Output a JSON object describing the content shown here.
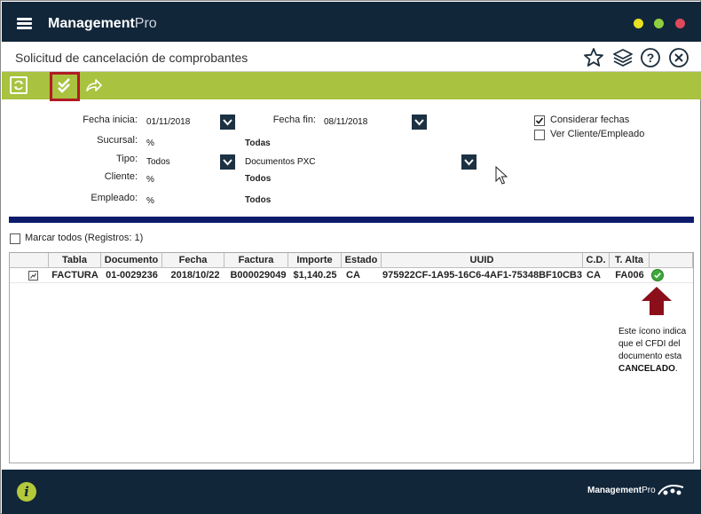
{
  "app": {
    "brand_main": "Management",
    "brand_pro": "Pro"
  },
  "window_controls": [
    "minimize",
    "maximize",
    "close"
  ],
  "header": {
    "title": "Solicitud de cancelación de comprobantes"
  },
  "toolbar": {
    "refresh_icon": "refresh-icon",
    "approve_icon": "double-check-icon",
    "share_icon": "forward-icon"
  },
  "filters": {
    "fecha_inicia_label": "Fecha inicia:",
    "fecha_inicia_value": "01/11/2018",
    "fecha_fin_label": "Fecha fin:",
    "fecha_fin_value": "08/11/2018",
    "sucursal_label": "Sucursal:",
    "sucursal_value": "%",
    "sucursal_desc": "Todas",
    "tipo_label": "Tipo:",
    "tipo_value": "Todos",
    "tipo_doc_value": "Documentos PXC",
    "cliente_label": "Cliente:",
    "cliente_value": "%",
    "cliente_desc": "Todos",
    "empleado_label": "Empleado:",
    "empleado_value": "%",
    "empleado_desc": "Todos",
    "considerar_fechas_label": "Considerar fechas",
    "considerar_fechas_checked": true,
    "ver_cliente_label": "Ver Cliente/Empleado",
    "ver_cliente_checked": false
  },
  "select_all": {
    "label": "Marcar todos (Registros: 1)"
  },
  "table": {
    "columns": [
      "Tabla",
      "Documento",
      "Fecha",
      "Factura",
      "Importe",
      "Estado",
      "UUID",
      "C.D.",
      "T. Alta"
    ],
    "rows": [
      {
        "tabla": "FACTURA",
        "documento": "01-0029236",
        "fecha": "2018/10/22",
        "factura": "B000029049",
        "importe": "$1,140.25",
        "estado": "CA",
        "uuid": "975922CF-1A95-16C6-4AF1-75348BF10CB3",
        "cd": "CA",
        "t_alta": "FA006",
        "status_icon": "check-circle-icon"
      }
    ]
  },
  "annotation": {
    "line1": "Este ícono indica",
    "line2": "que el CFDI del",
    "line3": "documento esta",
    "line4": "CANCELADO",
    "line4_suffix": "."
  },
  "footer": {
    "brand_main": "Management",
    "brand_pro": "Pro"
  },
  "colors": {
    "titlebar": "#12263a",
    "toolbar": "#a9c23f",
    "highlight": "#b01b25",
    "divider": "#0c1c6b",
    "arrow": "#8b0f1a"
  }
}
